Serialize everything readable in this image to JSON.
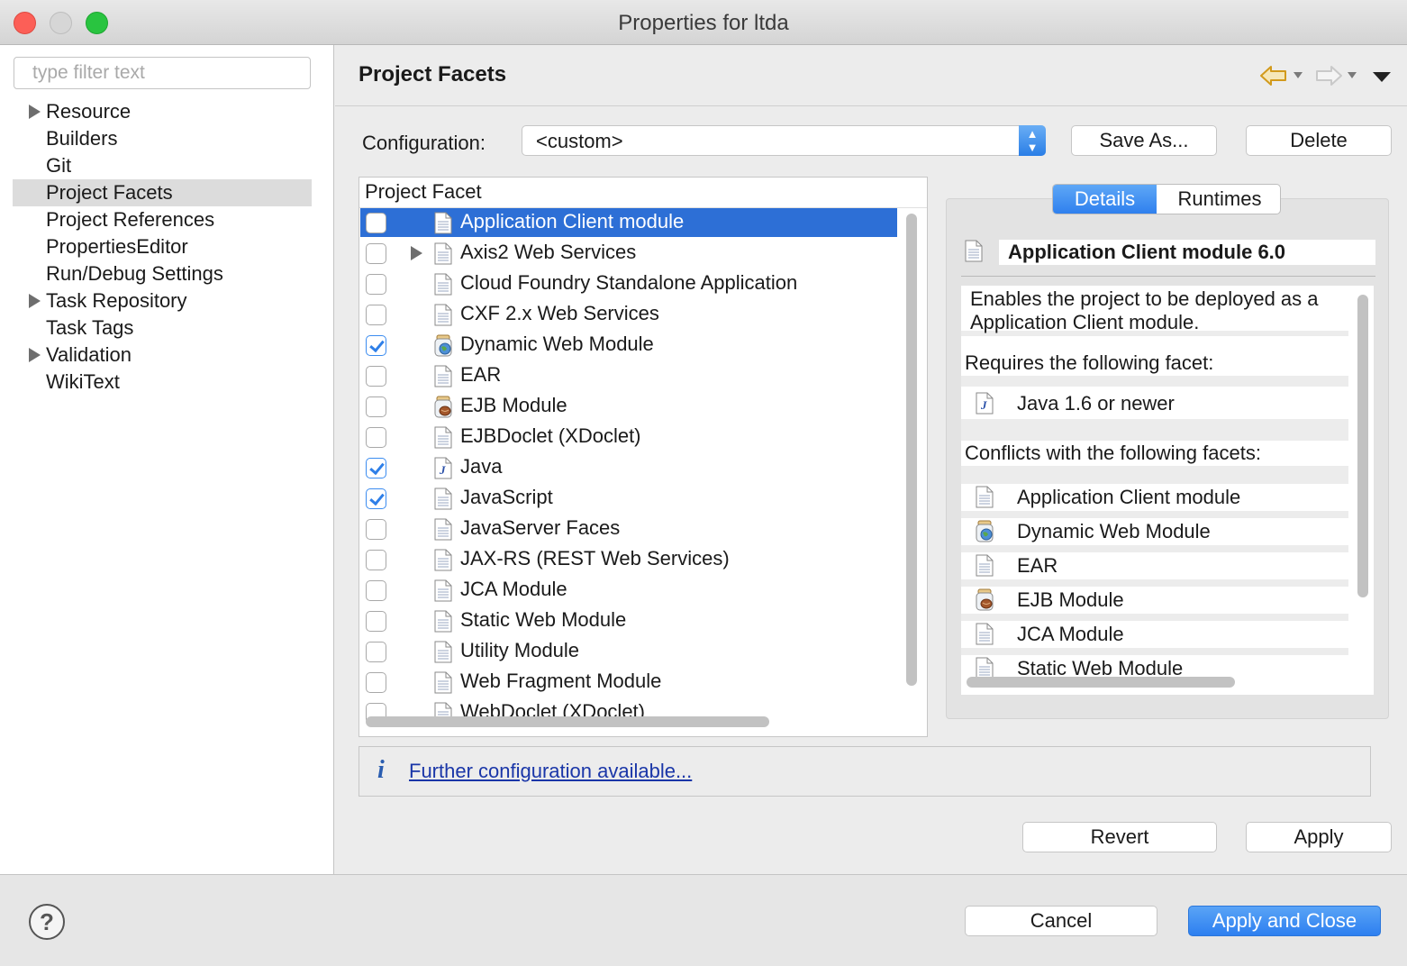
{
  "window": {
    "title": "Properties for ltda"
  },
  "sidebar": {
    "filter_placeholder": "type filter text",
    "items": [
      {
        "label": "Resource",
        "expandable": true,
        "selected": false
      },
      {
        "label": "Builders",
        "expandable": false,
        "selected": false
      },
      {
        "label": "Git",
        "expandable": false,
        "selected": false
      },
      {
        "label": "Project Facets",
        "expandable": false,
        "selected": true
      },
      {
        "label": "Project References",
        "expandable": false,
        "selected": false
      },
      {
        "label": "PropertiesEditor",
        "expandable": false,
        "selected": false
      },
      {
        "label": "Run/Debug Settings",
        "expandable": false,
        "selected": false
      },
      {
        "label": "Task Repository",
        "expandable": true,
        "selected": false
      },
      {
        "label": "Task Tags",
        "expandable": false,
        "selected": false
      },
      {
        "label": "Validation",
        "expandable": true,
        "selected": false
      },
      {
        "label": "WikiText",
        "expandable": false,
        "selected": false
      }
    ]
  },
  "header": {
    "title": "Project Facets",
    "back_icon": "back-arrow-icon",
    "forward_icon": "forward-arrow-icon",
    "menu_icon": "view-menu-icon"
  },
  "configuration": {
    "label": "Configuration:",
    "value": "<custom>",
    "save_as_label": "Save As...",
    "delete_label": "Delete"
  },
  "facets": {
    "column_header": "Project Facet",
    "rows": [
      {
        "label": "Application Client module",
        "checked": false,
        "selected": true,
        "icon": "file",
        "expandable": false
      },
      {
        "label": "Axis2 Web Services",
        "checked": false,
        "selected": false,
        "icon": "file",
        "expandable": true
      },
      {
        "label": "Cloud Foundry Standalone Application",
        "checked": false,
        "selected": false,
        "icon": "file",
        "expandable": false
      },
      {
        "label": "CXF 2.x Web Services",
        "checked": false,
        "selected": false,
        "icon": "file",
        "expandable": false
      },
      {
        "label": "Dynamic Web Module",
        "checked": true,
        "selected": false,
        "icon": "globe-jar",
        "expandable": false
      },
      {
        "label": "EAR",
        "checked": false,
        "selected": false,
        "icon": "file",
        "expandable": false
      },
      {
        "label": "EJB Module",
        "checked": false,
        "selected": false,
        "icon": "bean-jar",
        "expandable": false
      },
      {
        "label": "EJBDoclet (XDoclet)",
        "checked": false,
        "selected": false,
        "icon": "file",
        "expandable": false
      },
      {
        "label": "Java",
        "checked": true,
        "selected": false,
        "icon": "java",
        "expandable": false
      },
      {
        "label": "JavaScript",
        "checked": true,
        "selected": false,
        "icon": "file",
        "expandable": false
      },
      {
        "label": "JavaServer Faces",
        "checked": false,
        "selected": false,
        "icon": "file",
        "expandable": false
      },
      {
        "label": "JAX-RS (REST Web Services)",
        "checked": false,
        "selected": false,
        "icon": "file",
        "expandable": false
      },
      {
        "label": "JCA Module",
        "checked": false,
        "selected": false,
        "icon": "file",
        "expandable": false
      },
      {
        "label": "Static Web Module",
        "checked": false,
        "selected": false,
        "icon": "file",
        "expandable": false
      },
      {
        "label": "Utility Module",
        "checked": false,
        "selected": false,
        "icon": "file",
        "expandable": false
      },
      {
        "label": "Web Fragment Module",
        "checked": false,
        "selected": false,
        "icon": "file",
        "expandable": false
      },
      {
        "label": "WebDoclet (XDoclet)",
        "checked": false,
        "selected": false,
        "icon": "file",
        "expandable": false
      }
    ]
  },
  "details": {
    "tabs": [
      {
        "label": "Details",
        "active": true
      },
      {
        "label": "Runtimes",
        "active": false
      }
    ],
    "title": "Application Client module 6.0",
    "description": "Enables the project to be deployed as a Application Client module.",
    "requires_heading": "Requires the following facet:",
    "requires": [
      {
        "label": "Java 1.6 or newer",
        "icon": "java"
      }
    ],
    "conflicts_heading": "Conflicts with the following facets:",
    "conflicts": [
      {
        "label": "Application Client module",
        "icon": "file"
      },
      {
        "label": "Dynamic Web Module",
        "icon": "globe-jar"
      },
      {
        "label": "EAR",
        "icon": "file"
      },
      {
        "label": "EJB Module",
        "icon": "bean-jar"
      },
      {
        "label": "JCA Module",
        "icon": "file"
      },
      {
        "label": "Static Web Module",
        "icon": "file"
      }
    ]
  },
  "info": {
    "icon": "info-icon",
    "link_text": "Further configuration available..."
  },
  "page_buttons": {
    "revert_label": "Revert",
    "apply_label": "Apply"
  },
  "footer": {
    "help_icon": "help-icon",
    "cancel_label": "Cancel",
    "apply_close_label": "Apply and Close"
  },
  "colors": {
    "selection": "#2d6fd6",
    "primary_button": "#2d7ff0",
    "link": "#1a36a8"
  }
}
